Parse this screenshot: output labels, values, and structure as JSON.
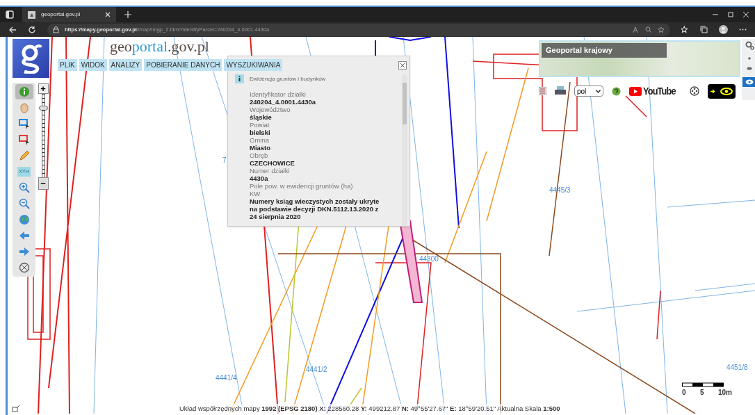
{
  "browser": {
    "tab_title": "geoportal.gov.pl",
    "url_host": "https://mapy.geoportal.gov.pl",
    "url_path": "/imap/Imgp_2.html?identifyParcel=240204_4.0001.4430a"
  },
  "header": {
    "logo_parts": [
      "geo",
      "portal",
      ".gov.pl"
    ],
    "menu": [
      {
        "label": "PLIK"
      },
      {
        "label": "WIDOK"
      },
      {
        "label": "ANALIZY"
      },
      {
        "label": "POBIERANIE DANYCH"
      },
      {
        "label": "WYSZUKIWANIA"
      }
    ]
  },
  "tools": [
    {
      "kind": "info",
      "selected": true
    },
    {
      "kind": "pan",
      "selected": false
    },
    {
      "kind": "select-blue",
      "selected": false
    },
    {
      "kind": "select-red",
      "selected": false
    },
    {
      "kind": "pencil",
      "selected": false
    },
    {
      "kind": "xyh",
      "label": "XYH",
      "selected": false
    },
    {
      "kind": "zoom-in",
      "selected": false
    },
    {
      "kind": "zoom-out",
      "selected": false
    },
    {
      "kind": "globe",
      "selected": false
    },
    {
      "kind": "back",
      "selected": false
    },
    {
      "kind": "forward",
      "selected": false
    },
    {
      "kind": "full",
      "selected": false
    }
  ],
  "zoom": {
    "plus": "+",
    "minus": "−",
    "level": 0.85
  },
  "popup": {
    "source": "Ewidencja gruntów i budynków",
    "fields": [
      {
        "label": "Identyfikator działki",
        "value": "240204_4.0001.4430a"
      },
      {
        "label": "Województwo",
        "value": "śląskie"
      },
      {
        "label": "Powiat",
        "value": "bielski"
      },
      {
        "label": "Gmina",
        "value": "Miasto"
      },
      {
        "label": "Obręb",
        "value": "CZECHOWICE"
      },
      {
        "label": "Numer działki",
        "value": "4430a"
      },
      {
        "label": "Pole pow. w ewidencji gruntów (ha)"
      },
      {
        "label": "KW",
        "value": "Numery ksiąg wieczystych zostały ukryte na podstawie decyzji DKN.5112.13.2020 z 24 sierpnia 2020"
      }
    ]
  },
  "overview": {
    "title": "Geoportal krajowy"
  },
  "toolbar": {
    "language": "pol",
    "youtube": "YouTube"
  },
  "map_labels": [
    {
      "text": "4445/3"
    },
    {
      "text": "4441/4"
    },
    {
      "text": "4441/2"
    },
    {
      "text": "4451/8"
    },
    {
      "text": "44300"
    },
    {
      "text": "7"
    }
  ],
  "scale": {
    "ticks": [
      "0",
      "5",
      "10m"
    ]
  },
  "status": "Układ współrzędnych mapy **1992 (EPSG 2180)** **X:** 228560.28 **Y:** 499212.87 **N:** 49°55'27.67\" **E:** 18°59'20.51\" Aktualna Skala **1:500**"
}
